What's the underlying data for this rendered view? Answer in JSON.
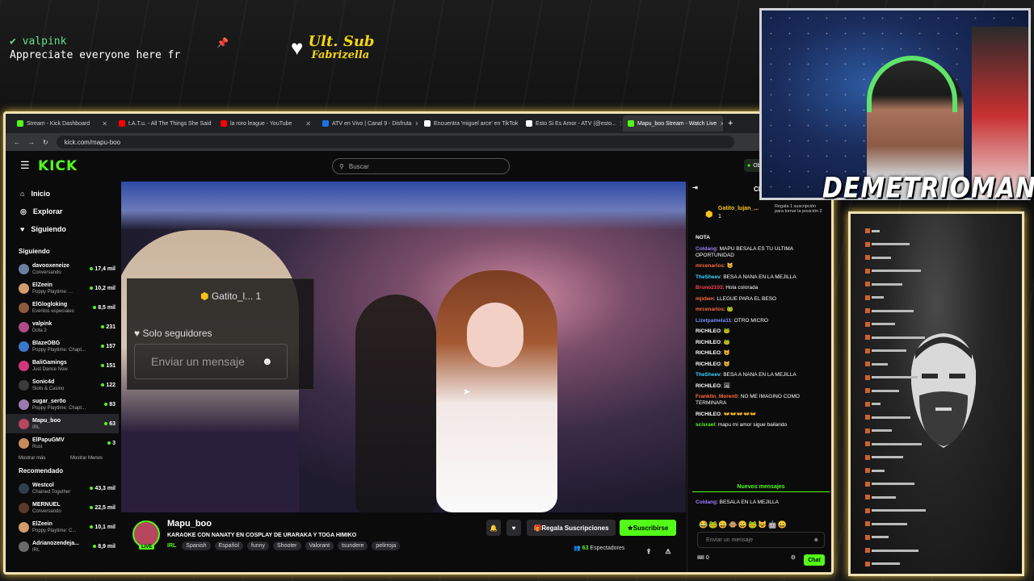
{
  "overlay": {
    "top_user": "valpink",
    "top_message": "Appreciate everyone here fr",
    "ult_sub_label": "Ult. Sub",
    "ult_sub_name": "Fabrizella",
    "streamer_name": "DEMETRIOMAN"
  },
  "browser": {
    "tabs": [
      {
        "label": "Stream - Kick Dashboard",
        "color": "#53fc18"
      },
      {
        "label": "t.A.T.u. - All The Things She Said",
        "color": "#ff0000"
      },
      {
        "label": "la roro league - YouTube",
        "color": "#ff0000"
      },
      {
        "label": "ATV en Vivo | Canal 9 - Disfruta",
        "color": "#1a73e8"
      },
      {
        "label": "Encuentra 'miguel arce' en TikTok",
        "color": "#ffffff"
      },
      {
        "label": "Esto Si Es Amor - ATV (@esto...",
        "color": "#ffffff"
      },
      {
        "label": "Mapu_boo Stream - Watch Live",
        "color": "#53fc18"
      }
    ],
    "url": "kick.com/mapu-boo"
  },
  "kick": {
    "logo": "KICK",
    "search_placeholder": "Buscar",
    "obtain_label": "Obt",
    "nav": [
      {
        "label": "Inicio",
        "icon": "home-icon"
      },
      {
        "label": "Explorar",
        "icon": "compass-icon"
      },
      {
        "label": "Siguiendo",
        "icon": "heart-icon"
      }
    ],
    "following_title": "Siguiendo",
    "following": [
      {
        "name": "davooxeneize",
        "category": "Conversando",
        "viewers": "17,4 mil",
        "color": "#6b7fa0"
      },
      {
        "name": "ElZeein",
        "category": "Poppy Playtime: ...",
        "viewers": "10,2 mil",
        "color": "#d39c6b"
      },
      {
        "name": "ElGlogloking",
        "category": "Eventos especiales",
        "viewers": "8,5 mil",
        "color": "#8c5a3c"
      },
      {
        "name": "valpink",
        "category": "Dota 2",
        "viewers": "231",
        "color": "#b04a88"
      },
      {
        "name": "BlazeOBG",
        "category": "Poppy Playtime: Chapt...",
        "viewers": "157",
        "color": "#3a78c9"
      },
      {
        "name": "BaliGamings",
        "category": "Just Dance Now",
        "viewers": "151",
        "color": "#d1377a"
      },
      {
        "name": "Sonic4d",
        "category": "Slots & Casino",
        "viewers": "122",
        "color": "#3b3b3b"
      },
      {
        "name": "sugar_ser0o",
        "category": "Poppy Playtime: Chapt...",
        "viewers": "83",
        "color": "#9a7ab0"
      },
      {
        "name": "Mapu_boo",
        "category": "IRL",
        "viewers": "63",
        "color": "#b7475e"
      },
      {
        "name": "ElPapuGMV",
        "category": "Rust",
        "viewers": "3",
        "color": "#c78a5c"
      }
    ],
    "show_more": "Mostrar más",
    "show_less": "Mostrar Menos",
    "recommended_title": "Recomendado",
    "recommended": [
      {
        "name": "Westcol",
        "category": "Chained Together",
        "viewers": "43,3 mil",
        "color": "#2f3f4f"
      },
      {
        "name": "MERNUEL",
        "category": "Conversando",
        "viewers": "22,5 mil",
        "color": "#5a3a2a"
      },
      {
        "name": "ElZeein",
        "category": "Poppy Playtime: C...",
        "viewers": "10,1 mil",
        "color": "#d39c6b"
      },
      {
        "name": "Adrianozendeja...",
        "category": "IRL",
        "viewers": "8,9 mil",
        "color": "#6a6a6a"
      }
    ]
  },
  "video_overlay": {
    "pinned_user": "Gatito_l...",
    "pinned_count": "1",
    "followers_only": "Solo seguidores",
    "input_placeholder": "Enviar un mensaje"
  },
  "stream": {
    "channel": "Mapu_boo",
    "live_label": "LIVE",
    "title": "KARAOKE CON NANATY EN COSPLAY DE URARAKA Y TOGA HIMIKO",
    "category": "IRL",
    "tags": [
      "Spanish",
      "Español",
      "funny",
      "Shooter",
      "Valorant",
      "tsundere",
      "pelirroja"
    ],
    "gift_button": "Regala Suscripciones",
    "subscribe_button": "Suscribirse",
    "viewers": "63",
    "viewers_label": "Espectadores"
  },
  "chat": {
    "title": "Chat",
    "gift_user": "Gatito_lujan_...",
    "gift_count": "1",
    "gift_text": "Regala 1 suscripción para tomar la posición 2",
    "messages": [
      {
        "user": "",
        "text": "NOTA",
        "color": "#ffffff"
      },
      {
        "user": "Coldang",
        "text": "MAPU BESALA ES TU ULTIMA OPORTUNIDAD",
        "color": "#9b7cff"
      },
      {
        "user": "mrcenarios",
        "text": "🐱",
        "color": "#ff6a3d"
      },
      {
        "user": "TheSheev",
        "text": "BESA A NANA EN LA MEJILLA",
        "color": "#3fd0ff"
      },
      {
        "user": "Bruno2103",
        "text": "Hola colorada",
        "color": "#ff3d5a"
      },
      {
        "user": "mjxben",
        "text": "LLEGUE PARA EL BESO",
        "color": "#ff6a3d"
      },
      {
        "user": "mrcenarios",
        "text": "🐸",
        "color": "#ff6a3d"
      },
      {
        "user": "Lizetpamela11",
        "text": "OTRO MICRO",
        "color": "#7a8cff"
      },
      {
        "user": "RICHILEO",
        "text": "🐸",
        "color": "#ffffff"
      },
      {
        "user": "RICHILEO",
        "text": "🐸",
        "color": "#ffffff"
      },
      {
        "user": "RICHILEO",
        "text": "😺",
        "color": "#ffffff"
      },
      {
        "user": "RICHILEO",
        "text": "😺",
        "color": "#ffffff"
      },
      {
        "user": "TheSheev",
        "text": "BESA A NANA EN LA MEJILLA",
        "color": "#3fd0ff"
      },
      {
        "user": "RICHILEO",
        "text": "🖼",
        "color": "#ffffff"
      },
      {
        "user": "Franklin_Moren0",
        "text": "NO ME IMAGINO COMO TERMINARA",
        "color": "#ff6a3d"
      },
      {
        "user": "RICHILEO",
        "text": "👐👐👐👐👐",
        "color": "#ffffff"
      },
      {
        "user": "scisrael",
        "text": "mapu mi amor sigue bailando",
        "color": "#53fc18"
      }
    ],
    "new_messages": "Nuevos mensajes",
    "after_new": {
      "user": "Coldang",
      "text": "BESALA EN LA MEJILLA",
      "color": "#9b7cff"
    },
    "emotes": "😂🐸😄🐵😀🐸😺🤖😀",
    "input_placeholder": "Enviar un mensaje",
    "points": "0",
    "send_button": "Chat"
  }
}
